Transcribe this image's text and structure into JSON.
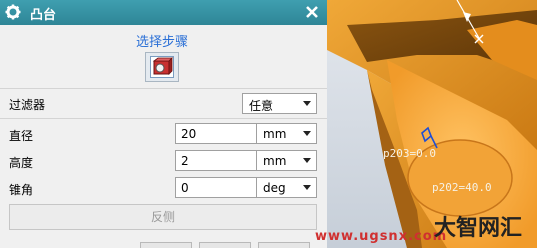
{
  "dialog": {
    "title": "凸台",
    "step_section_title": "选择步骤",
    "filter_label": "过滤器",
    "filter_value": "任意",
    "fields": [
      {
        "label": "直径",
        "value": "20",
        "unit": "mm"
      },
      {
        "label": "高度",
        "value": "2",
        "unit": "mm"
      },
      {
        "label": "锥角",
        "value": "0",
        "unit": "deg"
      }
    ],
    "reverse_button": "反侧"
  },
  "viewport": {
    "annotation_1": "p203=0.0",
    "annotation_2": "p202=40.0",
    "watermark_url": "www.ugsnx.com",
    "watermark_brand": "大智网汇"
  },
  "colors": {
    "titlebar": "#2e8596",
    "model_orange": "#e08f1e",
    "viewport_bg": "#d5dce4"
  }
}
